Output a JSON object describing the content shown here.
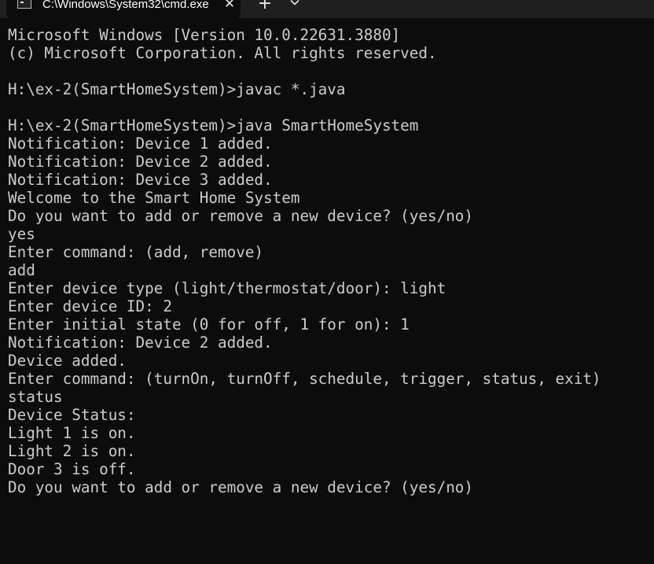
{
  "window": {
    "tab_title": "C:\\Windows\\System32\\cmd.exe",
    "close_glyph": "✕",
    "new_tab_glyph": "+",
    "icons": {
      "app": "cmd-icon",
      "close": "close-icon",
      "new_tab": "plus-icon",
      "dropdown": "chevron-down-icon"
    }
  },
  "console": {
    "lines": [
      "Microsoft Windows [Version 10.0.22631.3880]",
      "(c) Microsoft Corporation. All rights reserved.",
      "",
      "H:\\ex-2(SmartHomeSystem)>javac *.java",
      "",
      "H:\\ex-2(SmartHomeSystem)>java SmartHomeSystem",
      "Notification: Device 1 added.",
      "Notification: Device 2 added.",
      "Notification: Device 3 added.",
      "Welcome to the Smart Home System",
      "Do you want to add or remove a new device? (yes/no)",
      "yes",
      "Enter command: (add, remove)",
      "add",
      "Enter device type (light/thermostat/door): light",
      "Enter device ID: 2",
      "Enter initial state (0 for off, 1 for on): 1",
      "Notification: Device 2 added.",
      "Device added.",
      "Enter command: (turnOn, turnOff, schedule, trigger, status, exit)",
      "status",
      "Device Status:",
      "Light 1 is on.",
      "Light 2 is on.",
      "Door 3 is off.",
      "Do you want to add or remove a new device? (yes/no)"
    ]
  },
  "colors": {
    "background": "#0c0c0c",
    "titlebar": "#1f1f1f",
    "text": "#cccccc"
  }
}
